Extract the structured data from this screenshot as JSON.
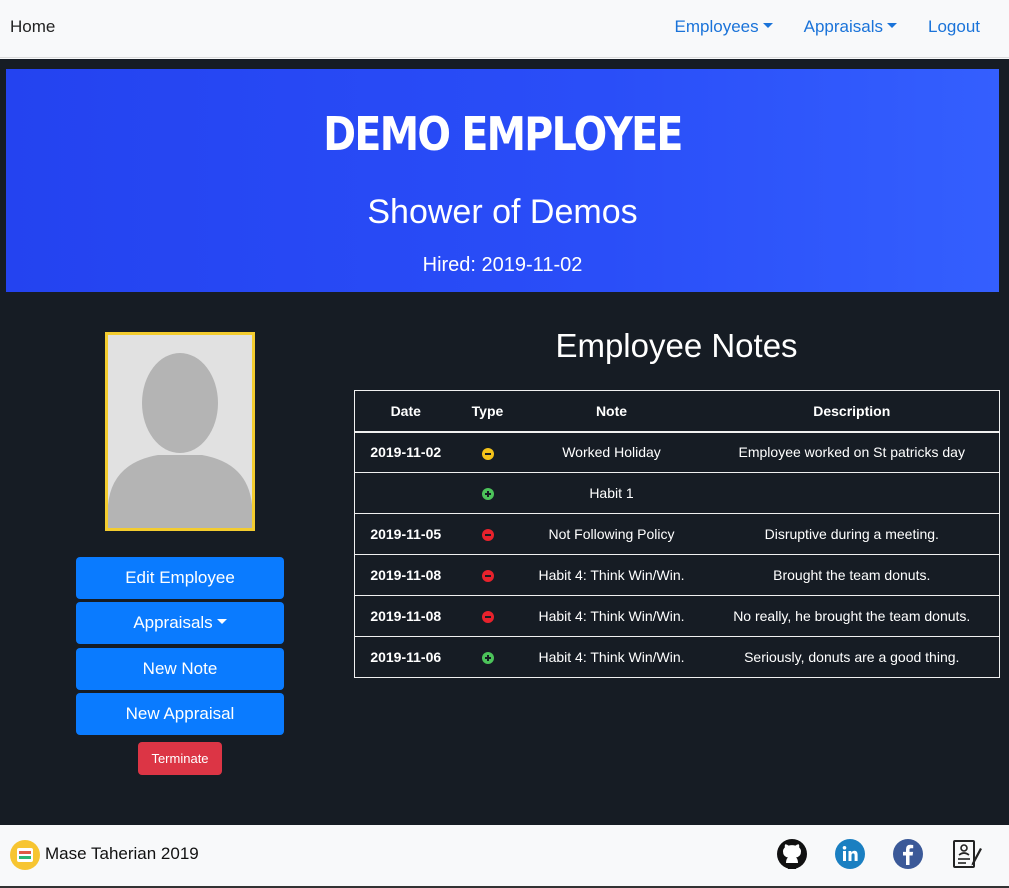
{
  "navbar": {
    "home": "Home",
    "employees": "Employees",
    "appraisals": "Appraisals",
    "logout": "Logout"
  },
  "banner": {
    "name": "Demo Employee",
    "job_title": "Shower of Demos",
    "hired": "Hired: 2019-11-02"
  },
  "sidebar": {
    "edit": "Edit Employee",
    "appraisals": "Appraisals",
    "new_note": "New Note",
    "new_appraisal": "New Appraisal",
    "terminate": "Terminate"
  },
  "notes": {
    "title": "Employee Notes",
    "headers": [
      "Date",
      "Type",
      "Note",
      "Description"
    ],
    "rows": [
      {
        "date": "2019-11-02",
        "type": "neutral",
        "note": "Worked Holiday",
        "description": "Employee worked on St patricks day"
      },
      {
        "date": "",
        "type": "positive",
        "note": "Habit 1",
        "description": ""
      },
      {
        "date": "2019-11-05",
        "type": "negative",
        "note": "Not Following Policy",
        "description": "Disruptive during a meeting."
      },
      {
        "date": "2019-11-08",
        "type": "negative",
        "note": "Habit 4: Think Win/Win.",
        "description": "Brought the team donuts."
      },
      {
        "date": "2019-11-08",
        "type": "negative",
        "note": "Habit 4: Think Win/Win.",
        "description": "No really, he brought the team donuts."
      },
      {
        "date": "2019-11-06",
        "type": "positive",
        "note": "Habit 4: Think Win/Win.",
        "description": "Seriously, donuts are a good thing."
      }
    ]
  },
  "colors": {
    "neutral": "#f3c21a",
    "positive": "#4cc35a",
    "negative": "#e8222c"
  },
  "footer": {
    "text": "Mase Taherian 2019",
    "icons": [
      "github-icon",
      "linkedin-icon",
      "facebook-icon",
      "resume-icon"
    ]
  }
}
